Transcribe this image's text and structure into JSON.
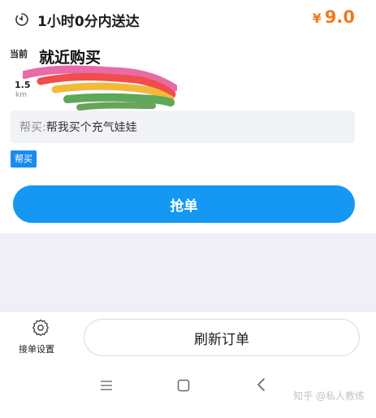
{
  "order": {
    "delivery_time": "1小时0分内送达",
    "price_currency": "¥",
    "price_amount": "9.0",
    "current_tag": "当前",
    "store_name": "就近购买",
    "distance_value": "1.5",
    "distance_unit": "km",
    "note_label": "帮买:",
    "note_text": "帮我买个充气娃娃",
    "type_badge": "帮买",
    "grab_button": "抢单"
  },
  "toolbar": {
    "settings_label": "接单设置",
    "refresh_button": "刷新订单"
  },
  "watermark": "知乎 @私人教练",
  "colors": {
    "accent_blue": "#1498f3",
    "price_orange": "#f07a1c",
    "badge_blue": "#1a8cf0"
  },
  "icons": [
    "timer-icon",
    "settings-gear-icon",
    "nav-menu-icon",
    "nav-home-icon",
    "nav-back-icon"
  ]
}
